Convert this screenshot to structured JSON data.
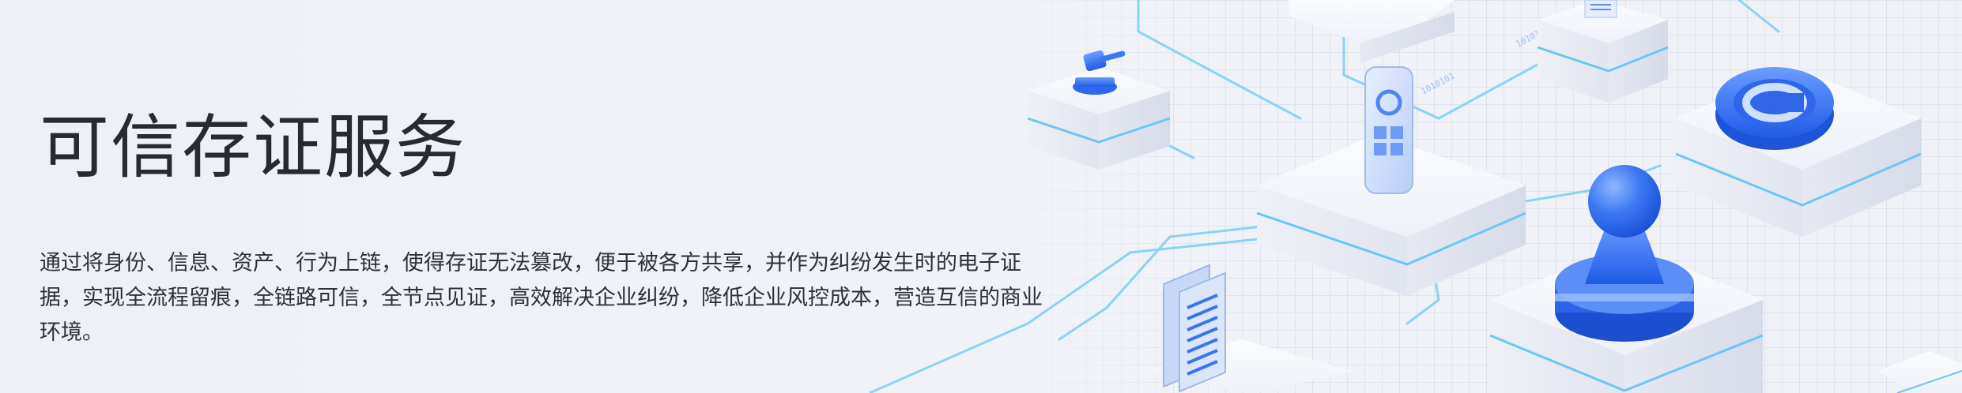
{
  "hero": {
    "title": "可信存证服务",
    "description": "通过将身份、信息、资产、行为上链，使得存证无法篡改，便于被各方共享，并作为纠纷发生时的电子证据，实现全流程留痕，全链路可信，全节点见证，高效解决企业纠纷，降低企业风控成本，营造互信的商业环境。"
  },
  "colors": {
    "background": "#eef0f6",
    "title": "#262a33",
    "text": "#2c3039",
    "accent": "#2f6cf0",
    "line": "#5cc8f5"
  },
  "illustration": {
    "icons": [
      "gavel-icon",
      "phone-icon",
      "document-icon",
      "stamp-icon",
      "copyright-icon"
    ]
  }
}
